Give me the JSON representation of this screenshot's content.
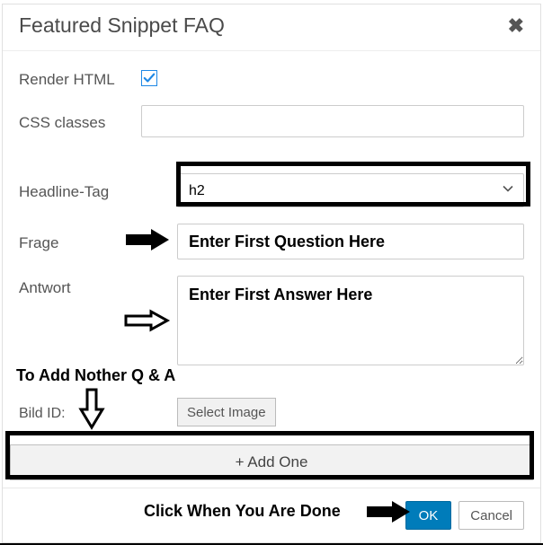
{
  "header": {
    "title": "Featured Snippet FAQ"
  },
  "fields": {
    "render_html": {
      "label": "Render HTML",
      "checked": true
    },
    "css_classes": {
      "label": "CSS classes",
      "value": ""
    },
    "headline_tag": {
      "label": "Headline-Tag",
      "selected": "h2"
    },
    "frage": {
      "label": "Frage",
      "value": "Enter First Question Here"
    },
    "antwort": {
      "label": "Antwort",
      "value": "Enter First Answer Here"
    },
    "bild_id": {
      "label": "Bild ID:",
      "button": "Select Image"
    }
  },
  "buttons": {
    "add_one": "+ Add One",
    "ok": "OK",
    "cancel": "Cancel"
  },
  "annotations": {
    "add_another": "To Add Nother Q &  A",
    "done": "Click When You Are Done"
  }
}
